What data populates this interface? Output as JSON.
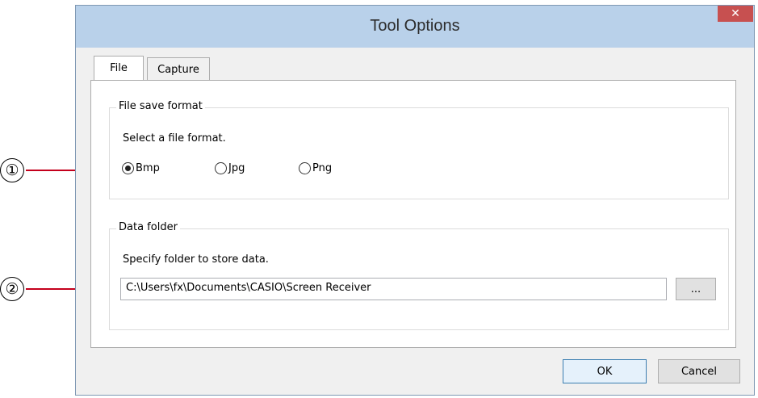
{
  "window": {
    "title": "Tool Options",
    "close_label": "✕"
  },
  "tabs": [
    {
      "label": "File",
      "active": true
    },
    {
      "label": "Capture",
      "active": false
    }
  ],
  "file_save_format": {
    "title": "File save format",
    "instruction": "Select a file format.",
    "options": [
      {
        "label": "Bmp",
        "selected": true
      },
      {
        "label": "Jpg",
        "selected": false
      },
      {
        "label": "Png",
        "selected": false
      }
    ]
  },
  "data_folder": {
    "title": "Data folder",
    "instruction": "Specify folder to store data.",
    "path": "C:\\Users\\fx\\Documents\\CASIO\\Screen Receiver",
    "browse_label": "..."
  },
  "buttons": {
    "ok": "OK",
    "cancel": "Cancel"
  },
  "callouts": {
    "one": "①",
    "two": "②"
  },
  "colors": {
    "callout_line": "#c4001c",
    "titlebar": "#b9d1ea",
    "close_button": "#c75050"
  }
}
